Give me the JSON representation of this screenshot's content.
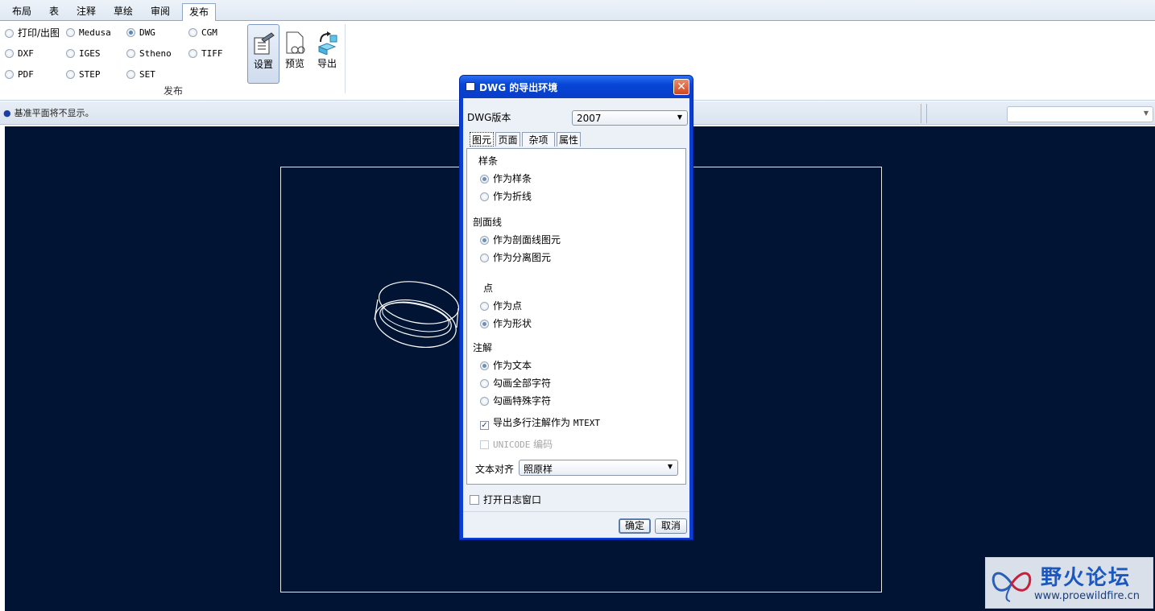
{
  "menu": {
    "tabs": [
      "布局",
      "表",
      "注释",
      "草绘",
      "审阅",
      "发布"
    ],
    "active_tab": "发布"
  },
  "ribbon": {
    "formats": [
      {
        "label": "打印/出图",
        "selected": false
      },
      {
        "label": "Medusa",
        "selected": false
      },
      {
        "label": "DWG",
        "selected": true
      },
      {
        "label": "CGM",
        "selected": false
      },
      {
        "label": "DXF",
        "selected": false
      },
      {
        "label": "IGES",
        "selected": false
      },
      {
        "label": "Stheno",
        "selected": false
      },
      {
        "label": "TIFF",
        "selected": false
      },
      {
        "label": "PDF",
        "selected": false
      },
      {
        "label": "STEP",
        "selected": false
      },
      {
        "label": "SET",
        "selected": false
      }
    ],
    "group_label": "发布",
    "buttons": {
      "settings": "设置",
      "preview": "预览",
      "export": "导出"
    }
  },
  "status": {
    "message": "基准平面将不显示。"
  },
  "dialog": {
    "title": "DWG 的导出环境",
    "version_label": "DWG版本",
    "version_value": "2007",
    "tabs": [
      "图元",
      "页面",
      "杂项",
      "属性"
    ],
    "active_tab": "图元",
    "spline": {
      "title": "样条",
      "options": [
        {
          "label": "作为样条",
          "selected": true
        },
        {
          "label": "作为折线",
          "selected": false
        }
      ]
    },
    "hatch": {
      "title": "剖面线",
      "options": [
        {
          "label": "作为剖面线图元",
          "selected": true
        },
        {
          "label": "作为分离图元",
          "selected": false
        }
      ]
    },
    "point": {
      "title": "点",
      "options": [
        {
          "label": "作为点",
          "selected": false
        },
        {
          "label": "作为形状",
          "selected": true
        }
      ]
    },
    "note": {
      "title": "注解",
      "options": [
        {
          "label": "作为文本",
          "selected": true
        },
        {
          "label": "勾画全部字符",
          "selected": false
        },
        {
          "label": "勾画特殊字符",
          "selected": false
        }
      ]
    },
    "mtext": {
      "prefix": "导出多行注解作为",
      "mono": "MTEXT",
      "checked": true
    },
    "unicode": {
      "mono": "UNICODE",
      "suffix": " 编码",
      "checked": false,
      "disabled": true
    },
    "align_label": "文本对齐",
    "align_value": "照原样",
    "log_label": "打开日志窗口",
    "ok": "确定",
    "cancel": "取消"
  },
  "watermark": {
    "title": "野火论坛",
    "url": "www.proewildfire.cn"
  }
}
